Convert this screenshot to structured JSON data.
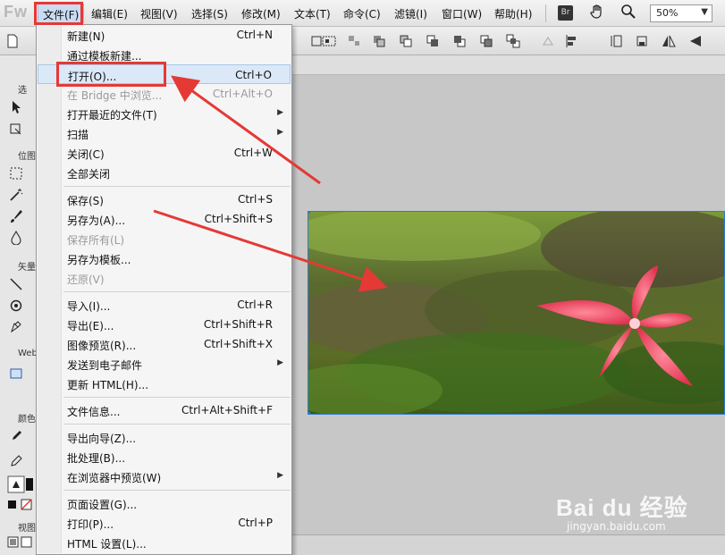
{
  "app": {
    "logo": "Fw"
  },
  "menubar": {
    "items": [
      {
        "label": "文件(F)"
      },
      {
        "label": "编辑(E)"
      },
      {
        "label": "视图(V)"
      },
      {
        "label": "选择(S)"
      },
      {
        "label": "修改(M)"
      },
      {
        "label": "文本(T)"
      },
      {
        "label": "命令(C)"
      },
      {
        "label": "滤镜(I)"
      },
      {
        "label": "窗口(W)"
      },
      {
        "label": "帮助(H)"
      }
    ],
    "bridge_label": "Br",
    "zoom": "50%"
  },
  "toolpanel": {
    "sections": [
      {
        "label": "选"
      },
      {
        "label": "位图"
      },
      {
        "label": "矢量"
      },
      {
        "label": "Web"
      },
      {
        "label": "颜色"
      },
      {
        "label": "视图"
      }
    ]
  },
  "file_menu": {
    "items": [
      {
        "label": "新建(N)",
        "shortcut": "Ctrl+N"
      },
      {
        "label": "通过模板新建...",
        "shortcut": ""
      },
      {
        "label": "打开(O)...",
        "shortcut": "Ctrl+O"
      },
      {
        "label": "在 Bridge 中浏览...",
        "shortcut": "Ctrl+Alt+O"
      },
      {
        "label": "打开最近的文件(T)",
        "shortcut": ""
      },
      {
        "label": "扫描",
        "shortcut": ""
      },
      {
        "label": "关闭(C)",
        "shortcut": "Ctrl+W"
      },
      {
        "label": "全部关闭",
        "shortcut": ""
      },
      {
        "label": "保存(S)",
        "shortcut": "Ctrl+S"
      },
      {
        "label": "另存为(A)...",
        "shortcut": "Ctrl+Shift+S"
      },
      {
        "label": "保存所有(L)",
        "shortcut": ""
      },
      {
        "label": "另存为模板...",
        "shortcut": ""
      },
      {
        "label": "还原(V)",
        "shortcut": ""
      },
      {
        "label": "导入(I)...",
        "shortcut": "Ctrl+R"
      },
      {
        "label": "导出(E)...",
        "shortcut": "Ctrl+Shift+R"
      },
      {
        "label": "图像预览(R)...",
        "shortcut": "Ctrl+Shift+X"
      },
      {
        "label": "发送到电子邮件",
        "shortcut": ""
      },
      {
        "label": "更新 HTML(H)...",
        "shortcut": ""
      },
      {
        "label": "文件信息...",
        "shortcut": "Ctrl+Alt+Shift+F"
      },
      {
        "label": "导出向导(Z)...",
        "shortcut": ""
      },
      {
        "label": "批处理(B)...",
        "shortcut": ""
      },
      {
        "label": "在浏览器中预览(W)",
        "shortcut": ""
      },
      {
        "label": "页面设置(G)...",
        "shortcut": ""
      },
      {
        "label": "打印(P)...",
        "shortcut": "Ctrl+P"
      },
      {
        "label": "HTML 设置(L)...",
        "shortcut": ""
      }
    ]
  },
  "watermark": {
    "text": "Bai du 经验",
    "url": "jingyan.baidu.com"
  },
  "colors": {
    "highlight_border": "#e53935",
    "selection_blue": "#2b7bd4"
  }
}
